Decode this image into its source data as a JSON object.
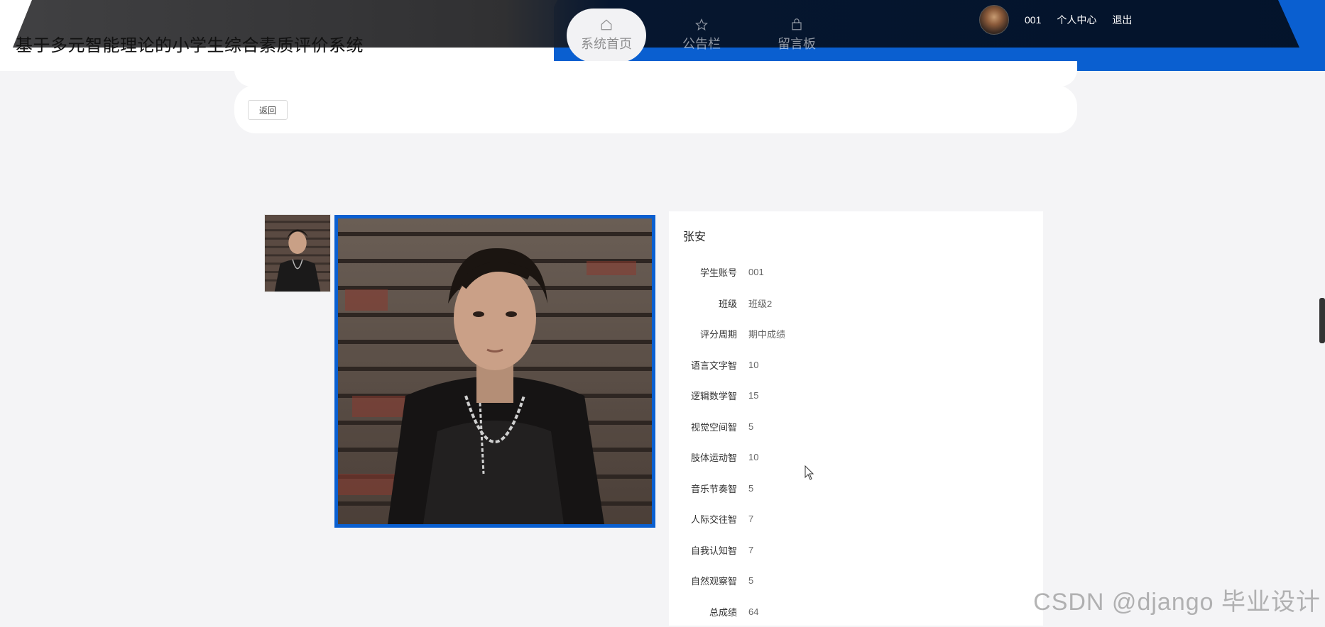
{
  "app": {
    "title": "基于多元智能理论的小学生综合素质评价系统"
  },
  "nav": [
    {
      "label": "系统首页",
      "icon": "home-icon",
      "active": true
    },
    {
      "label": "公告栏",
      "icon": "star-icon",
      "active": false
    },
    {
      "label": "留言板",
      "icon": "bag-icon",
      "active": false
    }
  ],
  "user": {
    "username": "001",
    "profile_label": "个人中心",
    "logout_label": "退出"
  },
  "toolbar": {
    "back_label": "返回"
  },
  "detail": {
    "name": "张安",
    "fields": [
      {
        "label": "学生账号",
        "value": "001"
      },
      {
        "label": "班级",
        "value": "班级2"
      },
      {
        "label": "评分周期",
        "value": "期中成绩"
      },
      {
        "label": "语言文字智",
        "value": "10"
      },
      {
        "label": "逻辑数学智",
        "value": "15"
      },
      {
        "label": "视觉空间智",
        "value": "5"
      },
      {
        "label": "肢体运动智",
        "value": "10"
      },
      {
        "label": "音乐节奏智",
        "value": "5"
      },
      {
        "label": "人际交往智",
        "value": "7"
      },
      {
        "label": "自我认知智",
        "value": "7"
      },
      {
        "label": "自然观察智",
        "value": "5"
      },
      {
        "label": "总成绩",
        "value": "64"
      }
    ]
  },
  "watermark": "CSDN @django 毕业设计",
  "colors": {
    "accent": "#0a5fd0",
    "header_dark": "#031126"
  }
}
